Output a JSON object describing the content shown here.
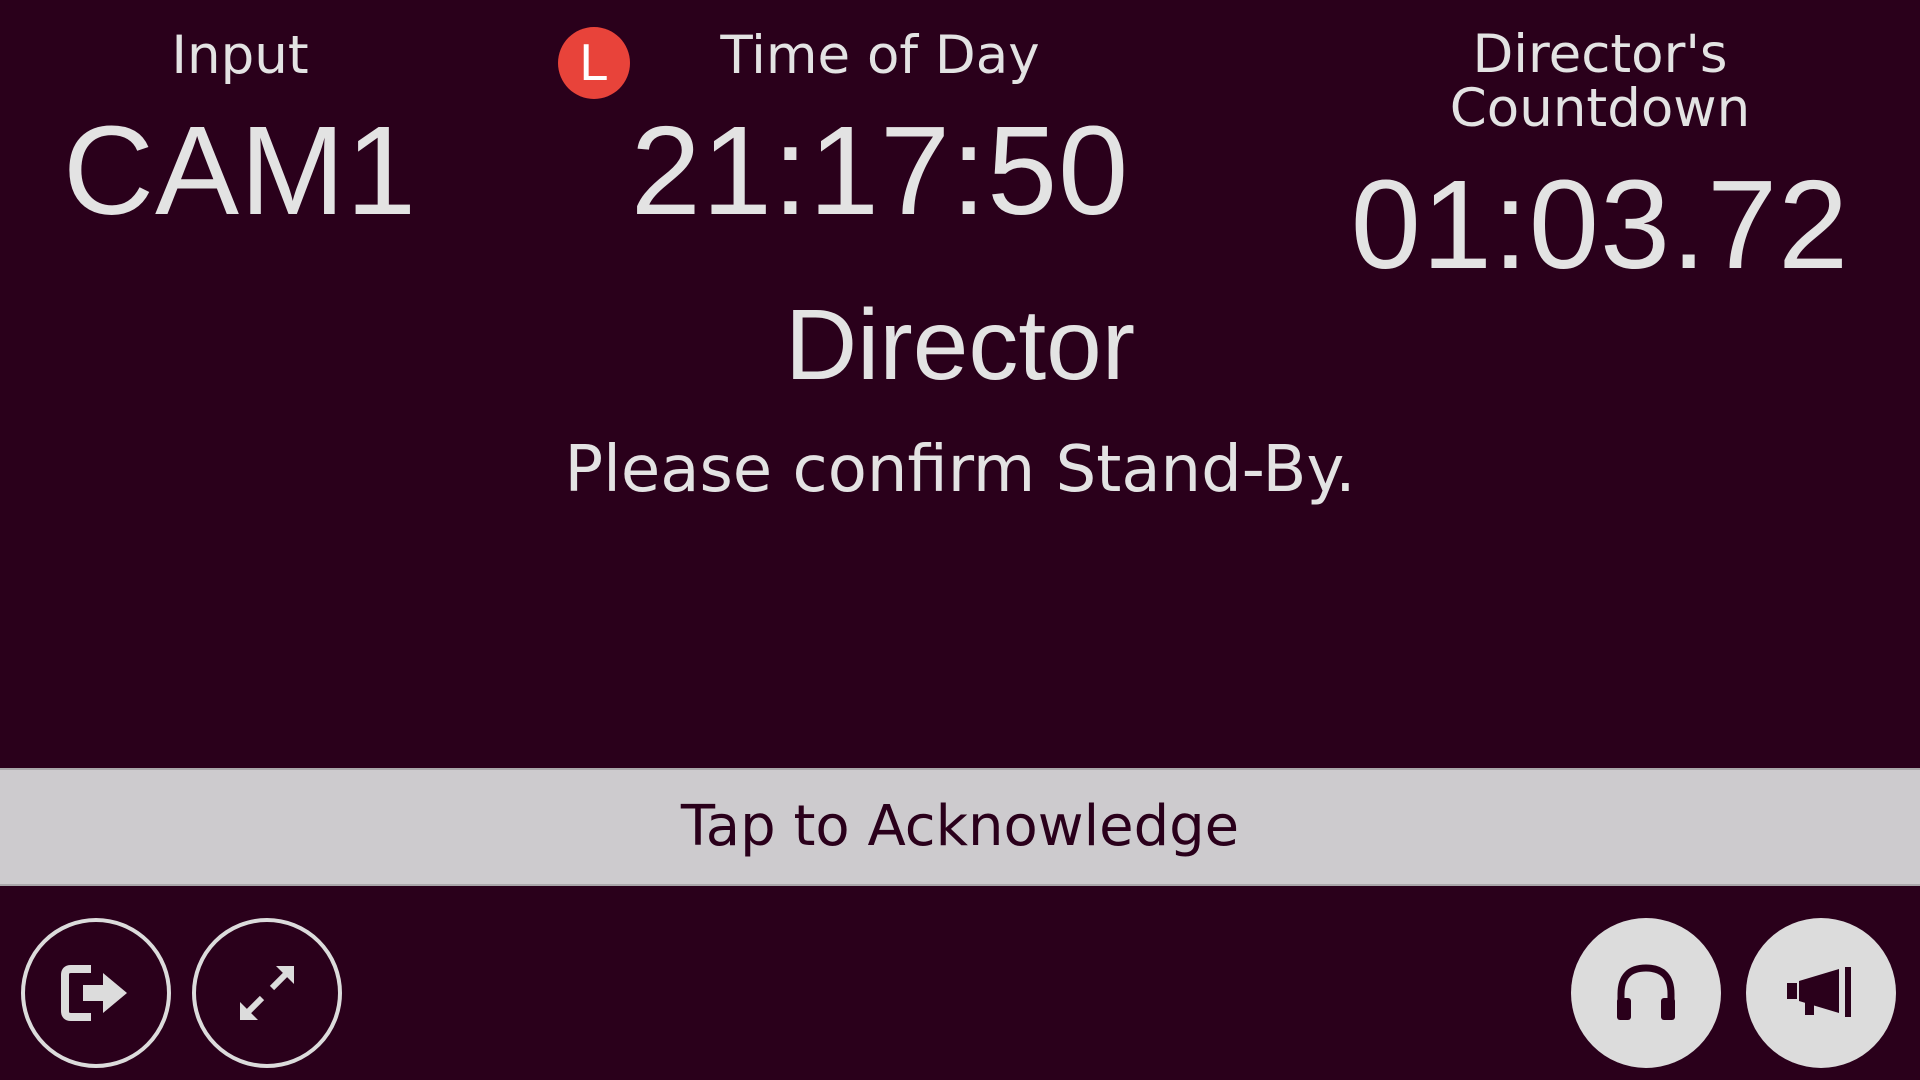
{
  "input": {
    "label": "Input",
    "value": "CAM1"
  },
  "time_of_day": {
    "label": "Time of Day",
    "value": "21:17:50"
  },
  "live_badge": {
    "letter": "L",
    "color": "#e8433a"
  },
  "countdown": {
    "label_line1": "Director's",
    "label_line2": "Countdown",
    "value": "01:03.72"
  },
  "message": {
    "sender": "Director",
    "text": "Please confirm Stand-By."
  },
  "acknowledge": {
    "label": "Tap to Acknowledge"
  },
  "toolbar": {
    "left": [
      {
        "name": "logout",
        "icon": "exit-icon"
      },
      {
        "name": "fullscreen",
        "icon": "expand-icon"
      }
    ],
    "right": [
      {
        "name": "headset",
        "icon": "headphones-icon"
      },
      {
        "name": "announce",
        "icon": "megaphone-icon"
      }
    ]
  },
  "colors": {
    "background": "#2a001b",
    "text": "#e3e3e3",
    "ack_bar": "#cdcbce",
    "badge": "#e8433a",
    "button_fill": "#dcdcdc"
  }
}
